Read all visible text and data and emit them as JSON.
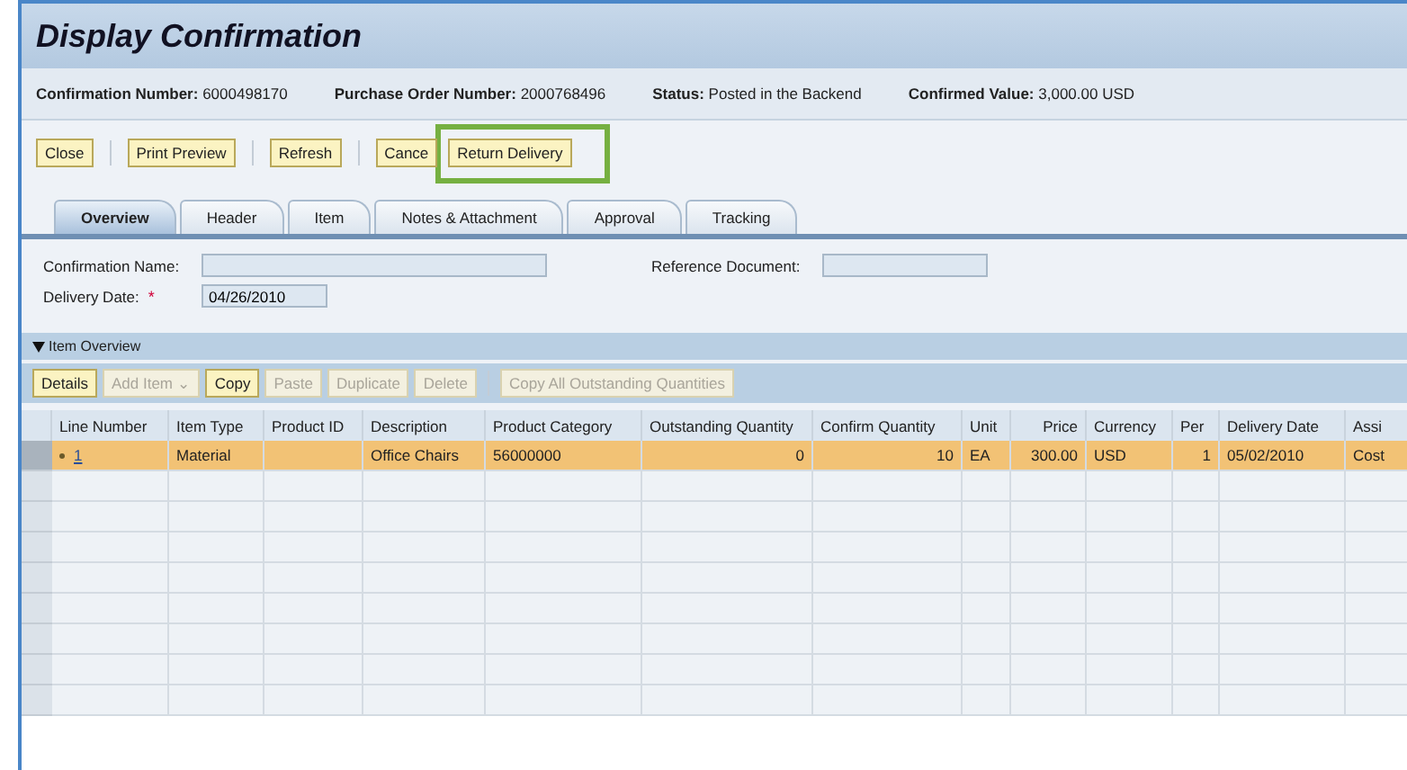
{
  "window": {
    "title": "Display Confirmation"
  },
  "header_fields": [
    {
      "label": "Confirmation Number:",
      "value": "6000498170"
    },
    {
      "label": "Purchase Order Number:",
      "value": "2000768496"
    },
    {
      "label": "Status:",
      "value": "Posted in the Backend"
    },
    {
      "label": "Confirmed Value:",
      "value": "3,000.00 USD"
    }
  ],
  "toolbar": [
    {
      "label": "Close",
      "highlighted": false
    },
    {
      "label": "Print Preview",
      "highlighted": false
    },
    {
      "label": "Refresh",
      "highlighted": false
    },
    {
      "label": "Cance",
      "highlighted": false
    },
    {
      "label": "Return Delivery",
      "highlighted": true
    }
  ],
  "tabs": [
    {
      "label": "Overview",
      "selected": true
    },
    {
      "label": "Header",
      "selected": false
    },
    {
      "label": "Item",
      "selected": false
    },
    {
      "label": "Notes & Attachment",
      "selected": false
    },
    {
      "label": "Approval",
      "selected": false
    },
    {
      "label": "Tracking",
      "selected": false
    }
  ],
  "form": {
    "confirmation_name": {
      "label": "Confirmation Name:"
    },
    "reference_document": {
      "label": "Reference Document:"
    },
    "delivery_date": {
      "label": "Delivery Date:",
      "required_mark": "*",
      "value": "04/26/2010"
    }
  },
  "item_overview": {
    "title": "Item Overview",
    "expanded": true,
    "buttons": [
      {
        "label": "Details",
        "disabled": false
      },
      {
        "label": "Add Item",
        "disabled": true,
        "menu_mark": "⌄"
      },
      {
        "label": "Copy",
        "disabled": false
      },
      {
        "label": "Paste",
        "disabled": true
      },
      {
        "label": "Duplicate",
        "disabled": true
      },
      {
        "label": "Delete",
        "disabled": true
      },
      {
        "label": "Copy All Outstanding Quantities",
        "disabled": true
      }
    ],
    "columns": [
      "Line Number",
      "Item Type",
      "Product ID",
      "Description",
      "Product Category",
      "Outstanding Quantity",
      "Confirm Quantity",
      "Unit",
      "Price",
      "Currency",
      "Per",
      "Delivery Date",
      "Assi"
    ],
    "rows": [
      {
        "selected": true,
        "cells": [
          "1",
          "Material",
          "",
          "Office Chairs",
          "56000000",
          "0",
          "10",
          "EA",
          "300.00",
          "USD",
          "1",
          "05/02/2010",
          "Cost"
        ]
      }
    ]
  }
}
